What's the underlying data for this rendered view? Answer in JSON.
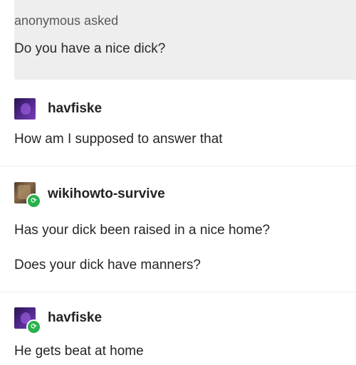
{
  "ask": {
    "header": "anonymous asked",
    "question": "Do you have a nice dick?"
  },
  "posts": [
    {
      "username": "havfiske",
      "avatar_icon": "purple-avatar",
      "reblogged": false,
      "lines": [
        "How am I supposed to answer that"
      ]
    },
    {
      "username": "wikihowto-survive",
      "avatar_icon": "photo-avatar",
      "reblogged": true,
      "lines": [
        "Has your dick been raised in a nice home?",
        "Does your dick have manners?"
      ]
    },
    {
      "username": "havfiske",
      "avatar_icon": "purple-avatar",
      "reblogged": true,
      "lines": [
        "He gets beat at home"
      ]
    }
  ],
  "colors": {
    "ask_background": "#eeeeee",
    "reblog_badge": "#27b14a",
    "text": "#262626"
  }
}
